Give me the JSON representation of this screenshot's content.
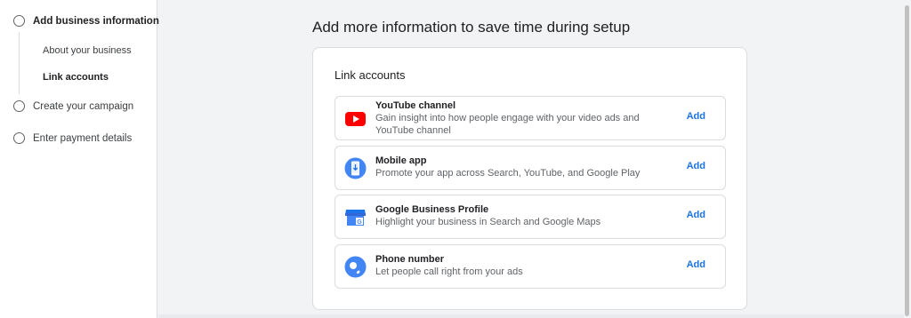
{
  "sidebar": {
    "steps": [
      {
        "label": "Add business information"
      },
      {
        "label": "Create your campaign"
      },
      {
        "label": "Enter payment details"
      }
    ],
    "substeps": [
      {
        "label": "About your business"
      },
      {
        "label": "Link accounts"
      }
    ]
  },
  "main": {
    "title": "Add more information to save time during setup",
    "card": {
      "title": "Link accounts",
      "rows": [
        {
          "name": "YouTube channel",
          "desc": "Gain insight into how people engage with your video ads and YouTube channel",
          "action": "Add",
          "icon": "youtube-icon"
        },
        {
          "name": "Mobile app",
          "desc": "Promote your app across Search, YouTube, and Google Play",
          "action": "Add",
          "icon": "mobile-app-icon"
        },
        {
          "name": "Google Business Profile",
          "desc": "Highlight your business in Search and Google Maps",
          "action": "Add",
          "icon": "business-profile-icon"
        },
        {
          "name": "Phone number",
          "desc": "Let people call right from your ads",
          "action": "Add",
          "icon": "phone-icon"
        }
      ]
    }
  },
  "colors": {
    "accent": "#1a73e8",
    "youtube": "#ff0000",
    "icon_blue": "#4285f4"
  }
}
